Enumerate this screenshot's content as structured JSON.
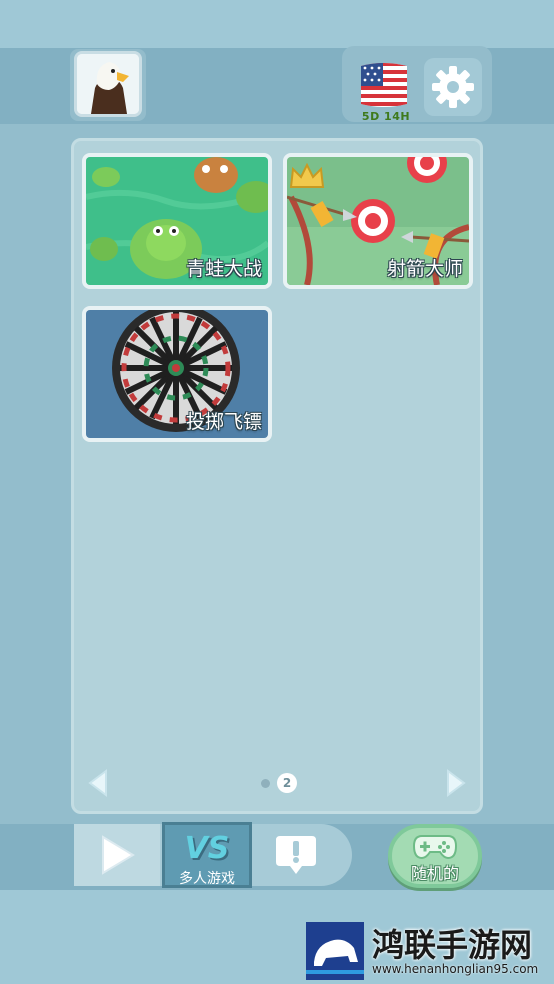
{
  "header": {
    "avatar_icon": "eagle-avatar-icon",
    "region_flag_icon": "us-flag-icon",
    "event_timer": "5D 14H",
    "settings_icon": "gear-icon"
  },
  "games": [
    {
      "name": "青蛙大战",
      "icon": "frog-pond-thumbnail"
    },
    {
      "name": "射箭大师",
      "icon": "archery-thumbnail",
      "badge": "crown-icon"
    },
    {
      "name": "投掷飞镖",
      "icon": "dartboard-thumbnail"
    }
  ],
  "pager": {
    "current_page": "2",
    "prev_icon": "arrow-left-icon",
    "next_icon": "arrow-right-icon"
  },
  "nav": {
    "play_icon": "play-icon",
    "vs_text": "VS",
    "vs_label": "多人游戏",
    "alert_icon": "exclamation-icon",
    "random_label": "随机的",
    "random_icon": "gamepad-icon"
  },
  "watermark": {
    "title": "鸿联手游网",
    "url": "www.henanhonglian95.com"
  },
  "colors": {
    "background": "#8fbccc",
    "panel": "#b2d2da",
    "vs_tab": "#5f9bb2",
    "random_button": "#a3dbb3"
  }
}
